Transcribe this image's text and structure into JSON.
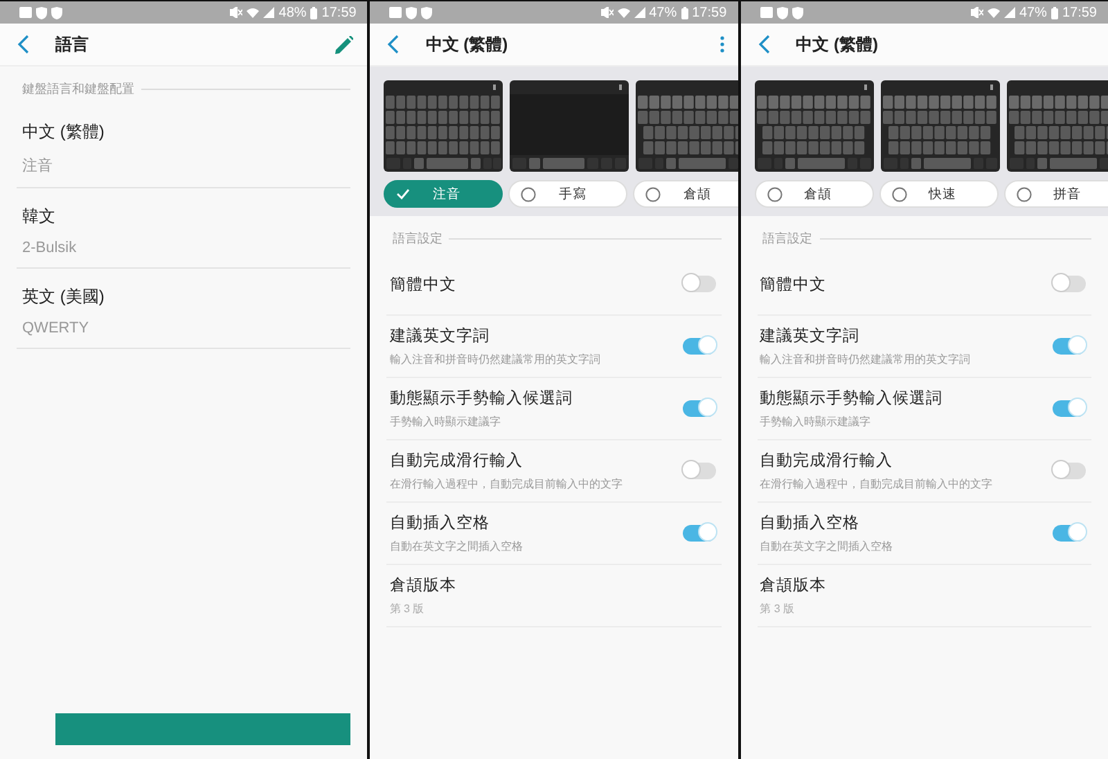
{
  "screens": [
    {
      "kind": "language_list",
      "status_bar": {
        "battery": "48%",
        "time": "17:59"
      },
      "app_bar": {
        "title": "語言",
        "actions": [
          {
            "kind": "edit"
          }
        ]
      },
      "section": "鍵盤語言和鍵盤配置",
      "languages": [
        {
          "name": "中文 (繁體)",
          "layout": "注音"
        },
        {
          "name": "韓文",
          "layout": "2-Bulsik"
        },
        {
          "name": "英文 (美國)",
          "layout": "QWERTY"
        }
      ],
      "bottom_button": true
    },
    {
      "kind": "layout_settings",
      "status_bar": {
        "battery": "47%",
        "time": "17:59"
      },
      "app_bar": {
        "title": "中文 (繁體)",
        "actions": [
          {
            "kind": "more"
          }
        ]
      },
      "layouts": [
        {
          "label": "注音",
          "selected": true,
          "kind": "grid"
        },
        {
          "label": "手寫",
          "selected": false,
          "kind": "handwriting"
        },
        {
          "label": "倉頡",
          "selected": false,
          "kind": "keys"
        }
      ],
      "section": "語言設定",
      "settings": [
        {
          "kind": "toggle",
          "title": "簡體中文",
          "on": false
        },
        {
          "kind": "toggle",
          "title": "建議英文字詞",
          "subtitle": "輸入注音和拼音時仍然建議常用的英文字詞",
          "on": true
        },
        {
          "kind": "toggle",
          "title": "動態顯示手勢輸入候選詞",
          "subtitle": "手勢輸入時顯示建議字",
          "on": true
        },
        {
          "kind": "toggle",
          "title": "自動完成滑行輸入",
          "subtitle": "在滑行輸入過程中，自動完成目前輸入中的文字",
          "on": false
        },
        {
          "kind": "toggle",
          "title": "自動插入空格",
          "subtitle": "自動在英文字之間插入空格",
          "on": true
        },
        {
          "kind": "info",
          "title": "倉頡版本",
          "subtitle": "第 3 版"
        }
      ]
    },
    {
      "kind": "layout_settings",
      "status_bar": {
        "battery": "47%",
        "time": "17:59"
      },
      "app_bar": {
        "title": "中文 (繁體)"
      },
      "layouts": [
        {
          "label": "倉頡",
          "selected": false,
          "kind": "keys"
        },
        {
          "label": "快速",
          "selected": false,
          "kind": "keys"
        },
        {
          "label": "拼音",
          "selected": false,
          "kind": "qwerty"
        }
      ],
      "section": "語言設定",
      "settings": [
        {
          "kind": "toggle",
          "title": "簡體中文",
          "on": false
        },
        {
          "kind": "toggle",
          "title": "建議英文字詞",
          "subtitle": "輸入注音和拼音時仍然建議常用的英文字詞",
          "on": true
        },
        {
          "kind": "toggle",
          "title": "動態顯示手勢輸入候選詞",
          "subtitle": "手勢輸入時顯示建議字",
          "on": true
        },
        {
          "kind": "toggle",
          "title": "自動完成滑行輸入",
          "subtitle": "在滑行輸入過程中，自動完成目前輸入中的文字",
          "on": false
        },
        {
          "kind": "toggle",
          "title": "自動插入空格",
          "subtitle": "自動在英文字之間插入空格",
          "on": true
        },
        {
          "kind": "info",
          "title": "倉頡版本",
          "subtitle": "第 3 版"
        }
      ]
    }
  ]
}
